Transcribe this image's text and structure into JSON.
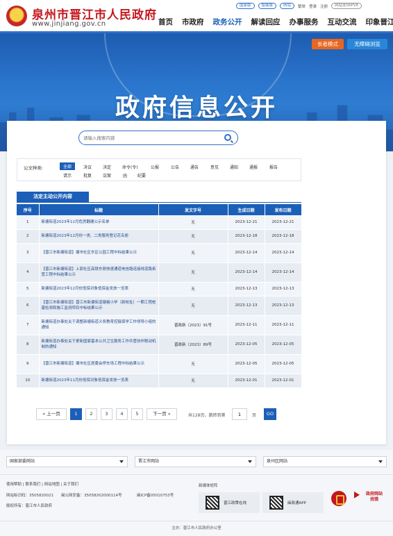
{
  "header": {
    "site_name": "泉州市晋江市人民政府",
    "site_url": "www.jinjiang.gov.cn",
    "top_links": [
      "国家版",
      "繁体",
      "登录",
      "注册"
    ],
    "top_pills": [
      "智能版",
      "网站",
      "网站支持IPV6"
    ],
    "nav": [
      "首页",
      "市政府",
      "政务公开",
      "解读回应",
      "办事服务",
      "互动交流",
      "印象晋江"
    ],
    "nav_active_index": 2,
    "accent_color": "#1b5fb8",
    "brand_red": "#c4161c"
  },
  "banner": {
    "title": "政府信息公开",
    "elder_mode": "长者模式",
    "accessibility": "无障碍浏览"
  },
  "search": {
    "placeholder": "请输入搜索内容"
  },
  "filter": {
    "label": "公文种类:",
    "types": [
      "全部",
      "决议",
      "决定",
      "命令(令)",
      "公报",
      "公告",
      "通告",
      "意见",
      "通知",
      "通报",
      "报告",
      "请示",
      "批复",
      "议案",
      "函",
      "纪要"
    ],
    "active_index": 0
  },
  "section_tab": "法定主动公开内容",
  "table": {
    "headers": [
      "序号",
      "标题",
      "发文字号",
      "生成日期",
      "发布日期"
    ],
    "rows": [
      {
        "no": "1",
        "title": "新塘街道2023年12月危房翻建公示名单",
        "doc_no": "无",
        "created": "2023-12-21",
        "published": "2023-12-21"
      },
      {
        "no": "2",
        "title": "新塘街道2023年12月份一类、二类服务登记花名册",
        "doc_no": "无",
        "created": "2023-12-18",
        "published": "2023-12-18"
      },
      {
        "no": "3",
        "title": "【晋江市新塘街道】塘市社区东区公园工程中标结果公示",
        "doc_no": "无",
        "created": "2023-12-14",
        "published": "2023-12-14"
      },
      {
        "no": "4",
        "title": "【晋江市新塘街道】上郭社区高铁东侧快速通道电信路连接线道路拓宽工程中标结果公示",
        "doc_no": "无",
        "created": "2023-12-14",
        "published": "2023-12-14"
      },
      {
        "no": "5",
        "title": "新塘街道2023年12月份低保对象低保金发放一览表",
        "doc_no": "无",
        "created": "2023-12-13",
        "published": "2023-12-13"
      },
      {
        "no": "6",
        "title": "【晋江市新塘街道】晋江市新塘街道塘格小学（新校址）一期工程桩基检测和施工监测项目中标结果公示",
        "doc_no": "无",
        "created": "2023-12-13",
        "published": "2023-12-13"
      },
      {
        "no": "7",
        "title": "新塘街道办事处关于调整新塘街道义务教育控辍保学工作领导小组的通知",
        "doc_no": "晋政新〔2023〕91号",
        "created": "2023-12-11",
        "published": "2023-12-11"
      },
      {
        "no": "8",
        "title": "新塘街道办事处关于更新国家基本公共卫生服务工作共管协作联动机制的通知",
        "doc_no": "晋政新〔2023〕89号",
        "created": "2023-12-05",
        "published": "2023-12-05"
      },
      {
        "no": "9",
        "title": "【晋江市新塘街道】塘市社区居委会停车场工程中标结果公示",
        "doc_no": "无",
        "created": "2023-12-05",
        "published": "2023-12-05"
      },
      {
        "no": "10",
        "title": "新塘街道2023年11月份低保对象低保金发放一览表",
        "doc_no": "无",
        "created": "2023-12-01",
        "published": "2023-12-01"
      }
    ]
  },
  "pager": {
    "prev": "« 上一页",
    "pages": [
      "1",
      "2",
      "3",
      "4",
      "5"
    ],
    "current_index": 0,
    "next": "下一页 »",
    "info": "共128页，跳转到第",
    "jump_value": "1",
    "unit": "页",
    "go": "GO"
  },
  "footer": {
    "selects": [
      "国家部委网站",
      "晋江市网站",
      "泉州区网站"
    ],
    "links": "使用帮助 | 联系我们 | 网站地图 | 关于我们",
    "record": "网站标识码：3505820021",
    "police": "闽公网安备：35058202000114号",
    "icp": "闽ICP备05010753号",
    "sponsor": "版权所有：晋江市人民政府",
    "media_title": "新媒体矩阵",
    "media": [
      "晋江政策在线",
      "闽政通APP"
    ],
    "error_badge": "政府网站 找错",
    "organizer": "主办：晋江市人民政府办公室"
  }
}
